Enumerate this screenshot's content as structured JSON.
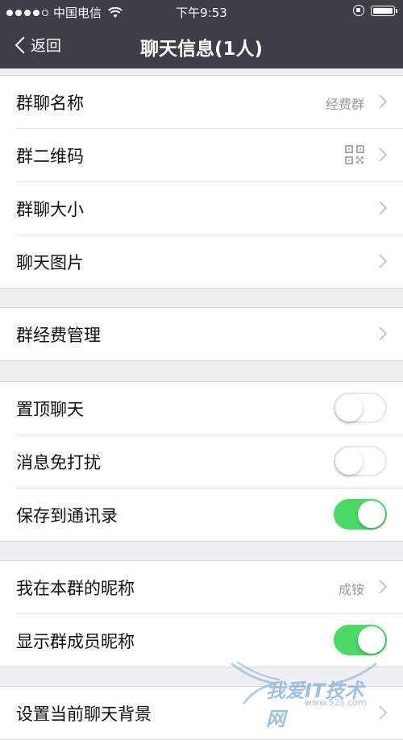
{
  "status_bar": {
    "carrier": "中国电信",
    "time": "下午9:53"
  },
  "nav": {
    "back_label": "返回",
    "title": "聊天信息(1人)"
  },
  "groups": [
    {
      "rows": [
        {
          "label": "群聊名称",
          "value": "经费群"
        },
        {
          "label": "群二维码"
        },
        {
          "label": "群聊大小"
        },
        {
          "label": "聊天图片"
        }
      ]
    },
    {
      "rows": [
        {
          "label": "群经费管理"
        }
      ]
    },
    {
      "rows": [
        {
          "label": "置顶聊天",
          "toggle": "off"
        },
        {
          "label": "消息免打扰",
          "toggle": "off"
        },
        {
          "label": "保存到通讯录",
          "toggle": "on"
        }
      ]
    },
    {
      "rows": [
        {
          "label": "我在本群的昵称",
          "value": "成铵"
        },
        {
          "label": "显示群成员昵称",
          "toggle": "on"
        }
      ]
    },
    {
      "rows": [
        {
          "label": "设置当前聊天背景"
        }
      ]
    }
  ],
  "watermark": {
    "text": "我爱IT技术网",
    "url": "www.52ij.com"
  },
  "colors": {
    "nav_bg": "#3d3f47",
    "toggle_on": "#4cd964",
    "page_bg": "#efeff4"
  }
}
